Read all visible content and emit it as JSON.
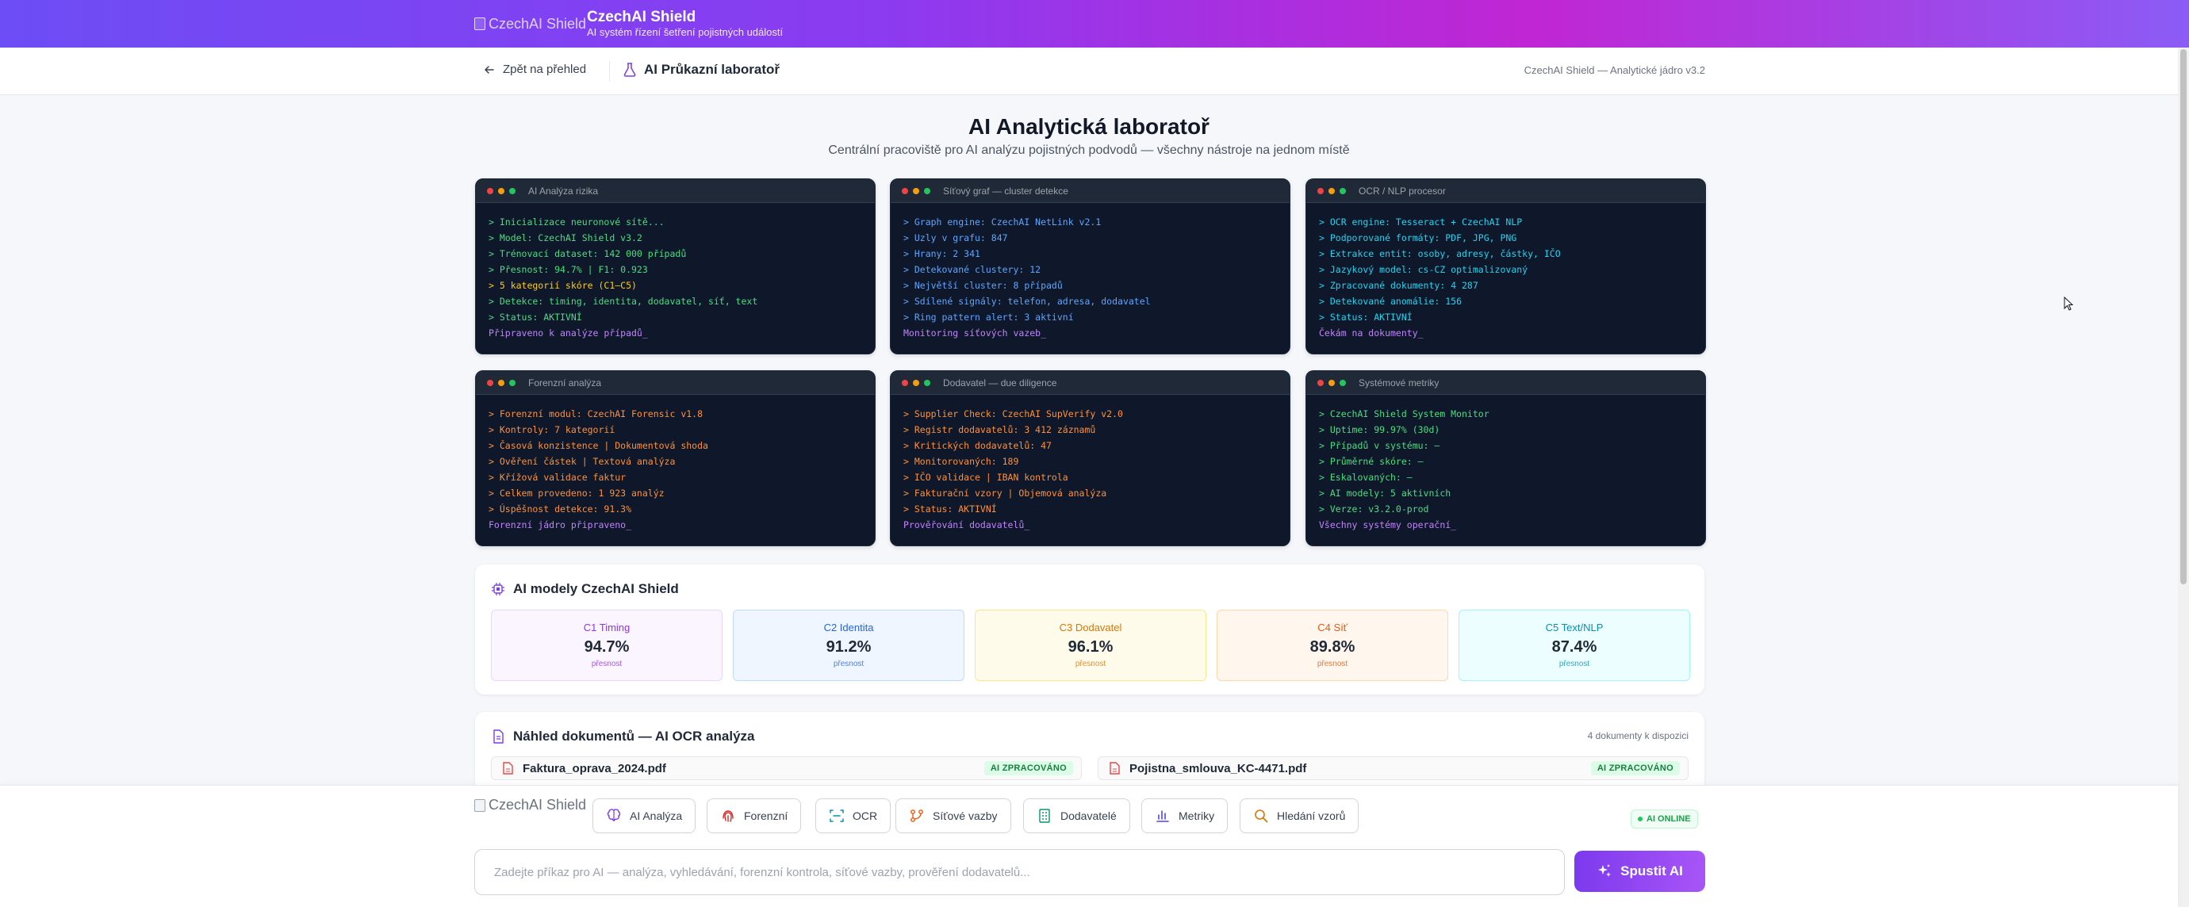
{
  "header": {
    "logo_alt": "CzechAI Shield",
    "title": "CzechAI Shield",
    "subtitle": "AI systém řízení šetření pojistných událostí"
  },
  "subnav": {
    "back_label": "Zpět na přehled",
    "lab_label": "AI Průkazní laboratoř",
    "version": "CzechAI Shield — Analytické jádro v3.2"
  },
  "main": {
    "title": "AI Analytická laboratoř",
    "subtitle": "Centrální pracoviště pro AI analýzu pojistných podvodů — všechny nástroje na jednom místě"
  },
  "terminals": [
    {
      "title": "AI Analýza rizika",
      "lines": [
        {
          "text": "> Inicializace neuronové sítě...",
          "color": "green"
        },
        {
          "text": "> Model: CzechAI Shield v3.2",
          "color": "green"
        },
        {
          "text": "> Trénovací dataset: 142 000 případů",
          "color": "green"
        },
        {
          "text": "> Přesnost: 94.7% | F1: 0.923",
          "color": "green"
        },
        {
          "text": "> 5 kategorií skóre (C1–C5)",
          "color": "yellow"
        },
        {
          "text": "> Detekce: timing, identita, dodavatel, síť, text",
          "color": "green"
        },
        {
          "text": "> Status: AKTIVNÍ",
          "color": "green"
        },
        {
          "text": "Připraveno k analýze případů_",
          "color": "purple"
        }
      ]
    },
    {
      "title": "Síťový graf — cluster detekce",
      "lines": [
        {
          "text": "> Graph engine: CzechAI NetLink v2.1",
          "color": "blue"
        },
        {
          "text": "> Uzly v grafu: 847",
          "color": "blue"
        },
        {
          "text": "> Hrany: 2 341",
          "color": "blue"
        },
        {
          "text": "> Detekované clustery: 12",
          "color": "blue"
        },
        {
          "text": "> Největší cluster: 8 případů",
          "color": "blue"
        },
        {
          "text": "> Sdílené signály: telefon, adresa, dodavatel",
          "color": "blue"
        },
        {
          "text": "> Ring pattern alert: 3 aktivní",
          "color": "blue"
        },
        {
          "text": "Monitoring síťových vazeb_",
          "color": "purple"
        }
      ]
    },
    {
      "title": "OCR / NLP procesor",
      "lines": [
        {
          "text": "> OCR engine: Tesseract + CzechAI NLP",
          "color": "cyan"
        },
        {
          "text": "> Podporované formáty: PDF, JPG, PNG",
          "color": "cyan"
        },
        {
          "text": "> Extrakce entit: osoby, adresy, částky, IČO",
          "color": "cyan"
        },
        {
          "text": "> Jazykový model: cs-CZ optimalizovaný",
          "color": "cyan"
        },
        {
          "text": "> Zpracované dokumenty: 4 287",
          "color": "cyan"
        },
        {
          "text": "> Detekované anomálie: 156",
          "color": "cyan"
        },
        {
          "text": "> Status: AKTIVNÍ",
          "color": "cyan"
        },
        {
          "text": "Čekám na dokumenty_",
          "color": "purple"
        }
      ]
    },
    {
      "title": "Forenzní analýza",
      "lines": [
        {
          "text": "> Forenzní modul: CzechAI Forensic v1.8",
          "color": "orange"
        },
        {
          "text": "> Kontroly: 7 kategorií",
          "color": "orange"
        },
        {
          "text": "> Časová konzistence | Dokumentová shoda",
          "color": "orange"
        },
        {
          "text": "> Ověření částek | Textová analýza",
          "color": "orange"
        },
        {
          "text": "> Křížová validace faktur",
          "color": "orange"
        },
        {
          "text": "> Celkem provedeno: 1 923 analýz",
          "color": "orange"
        },
        {
          "text": "> Úspěšnost detekce: 91.3%",
          "color": "orange"
        },
        {
          "text": "Forenzní jádro připraveno_",
          "color": "purple"
        }
      ]
    },
    {
      "title": "Dodavatel — due diligence",
      "lines": [
        {
          "text": "> Supplier Check: CzechAI SupVerify v2.0",
          "color": "orange"
        },
        {
          "text": "> Registr dodavatelů: 3 412 záznamů",
          "color": "orange"
        },
        {
          "text": "> Kritických dodavatelů: 47",
          "color": "orange"
        },
        {
          "text": "> Monitorovaných: 189",
          "color": "orange"
        },
        {
          "text": "> IČO validace | IBAN kontrola",
          "color": "orange"
        },
        {
          "text": "> Fakturační vzory | Objemová analýza",
          "color": "orange"
        },
        {
          "text": "> Status: AKTIVNÍ",
          "color": "orange"
        },
        {
          "text": "Prověřování dodavatelů_",
          "color": "purple"
        }
      ]
    },
    {
      "title": "Systémové metriky",
      "lines": [
        {
          "text": "> CzechAI Shield System Monitor",
          "color": "green"
        },
        {
          "text": "> Uptime: 99.97% (30d)",
          "color": "green"
        },
        {
          "text": "> Případů v systému: —",
          "color": "green"
        },
        {
          "text": "> Průměrné skóre: —",
          "color": "green"
        },
        {
          "text": "> Eskalovaných: —",
          "color": "green"
        },
        {
          "text": "> AI modely: 5 aktivních",
          "color": "green"
        },
        {
          "text": "> Verze: v3.2.0-prod",
          "color": "green"
        },
        {
          "text": "Všechny systémy operační_",
          "color": "purple"
        }
      ]
    }
  ],
  "models_card": {
    "title": "AI modely CzechAI Shield",
    "items": [
      {
        "name": "C1 Timing",
        "value": "94.7%",
        "label": "přesnost",
        "bg": "#faf5ff",
        "border": "#e9d5ff",
        "accent": "#9333ea"
      },
      {
        "name": "C2 Identita",
        "value": "91.2%",
        "label": "přesnost",
        "bg": "#eff6ff",
        "border": "#bfdbfe",
        "accent": "#2563eb"
      },
      {
        "name": "C3 Dodavatel",
        "value": "96.1%",
        "label": "přesnost",
        "bg": "#fffbeb",
        "border": "#fde68a",
        "accent": "#d97706"
      },
      {
        "name": "C4 Síť",
        "value": "89.8%",
        "label": "přesnost",
        "bg": "#fff7ed",
        "border": "#fed7aa",
        "accent": "#ea580c"
      },
      {
        "name": "C5 Text/NLP",
        "value": "87.4%",
        "label": "přesnost",
        "bg": "#ecfeff",
        "border": "#a5f3fc",
        "accent": "#0891b2"
      }
    ]
  },
  "docs_card": {
    "title": "Náhled dokumentů — AI OCR analýza",
    "count": "4 dokumenty k dispozici",
    "docs": [
      {
        "name": "Faktura_oprava_2024.pdf",
        "badge": "AI ZPRACOVÁNO"
      },
      {
        "name": "Pojistna_smlouva_KC-4471.pdf",
        "badge": "AI ZPRACOVÁNO"
      }
    ]
  },
  "command_bar": {
    "logo_alt": "CzechAI Shield",
    "tools": [
      "AI Analýza",
      "Forenzní",
      "OCR",
      "Síťové vazby",
      "Dodavatelé",
      "Metriky",
      "Hledání vzorů"
    ],
    "status": "AI ONLINE",
    "input_placeholder": "Zadejte příkaz pro AI — analýza, vyhledávání, forenzní kontrola, síťové vazby, prověření dodavatelů...",
    "input_value": "",
    "run_label": "Spustit AI"
  },
  "colors": {
    "accent": "#7c3aed",
    "header_gradient": [
      "#6d4df5",
      "#c026d3"
    ],
    "terminal_bg": "#0f172a"
  }
}
